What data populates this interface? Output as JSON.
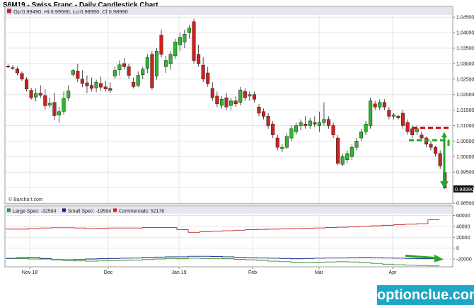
{
  "title": "S6M19 - Swiss Franc - Daily Candlestick Chart",
  "ohlc_label": "Op:0.99490, Hi:0.99590, Lo:0.98950, Cl:0.98990",
  "copyright": "© Barchart.com",
  "last_price": "0.98990",
  "brand": "optionclue.com",
  "colors": {
    "up": "#2db82d",
    "down": "#cc2222",
    "large": "#2f8f2f",
    "small": "#1a1a8c",
    "commercials": "#d02020",
    "arrow": "#22aa22",
    "resistance": "#cc1111",
    "support": "#22aa22"
  },
  "chart_data": [
    {
      "type": "candlestick",
      "x_ticks": [
        "Nov 18",
        "Dec",
        "Jan 19",
        "Feb",
        "Mar",
        "Apr"
      ],
      "y_ticks": [
        "1.04500",
        "1.04000",
        "1.03500",
        "1.03000",
        "1.02500",
        "1.02000",
        "1.01500",
        "1.01000",
        "1.00500",
        "1.00000",
        "0.99500",
        "0.99000",
        "0.98500"
      ],
      "ylim": [
        0.985,
        1.0455
      ],
      "candles": [
        {
          "o": 1.0292,
          "h": 1.0298,
          "l": 1.0285,
          "c": 1.0289
        },
        {
          "o": 1.0287,
          "h": 1.0294,
          "l": 1.028,
          "c": 1.0285
        },
        {
          "o": 1.0283,
          "h": 1.029,
          "l": 1.0262,
          "c": 1.027
        },
        {
          "o": 1.0268,
          "h": 1.0275,
          "l": 1.0244,
          "c": 1.025
        },
        {
          "o": 1.0248,
          "h": 1.0256,
          "l": 1.021,
          "c": 1.0218
        },
        {
          "o": 1.0214,
          "h": 1.0222,
          "l": 1.0184,
          "c": 1.019
        },
        {
          "o": 1.0192,
          "h": 1.022,
          "l": 1.0178,
          "c": 1.0204
        },
        {
          "o": 1.0205,
          "h": 1.023,
          "l": 1.0189,
          "c": 1.0198
        },
        {
          "o": 1.0197,
          "h": 1.0218,
          "l": 1.0152,
          "c": 1.0164
        },
        {
          "o": 1.0166,
          "h": 1.019,
          "l": 1.0158,
          "c": 1.0172
        },
        {
          "o": 1.0175,
          "h": 1.0206,
          "l": 1.0118,
          "c": 1.0132
        },
        {
          "o": 1.0134,
          "h": 1.016,
          "l": 1.011,
          "c": 1.0145
        },
        {
          "o": 1.0146,
          "h": 1.021,
          "l": 1.0135,
          "c": 1.0188
        },
        {
          "o": 1.019,
          "h": 1.023,
          "l": 1.018,
          "c": 1.0212
        },
        {
          "o": 1.0265,
          "h": 1.0282,
          "l": 1.0258,
          "c": 1.0278
        },
        {
          "o": 1.0276,
          "h": 1.03,
          "l": 1.024,
          "c": 1.0252
        },
        {
          "o": 1.025,
          "h": 1.0278,
          "l": 1.0224,
          "c": 1.0236
        },
        {
          "o": 1.0238,
          "h": 1.0262,
          "l": 1.0205,
          "c": 1.0228
        },
        {
          "o": 1.023,
          "h": 1.0255,
          "l": 1.021,
          "c": 1.022
        },
        {
          "o": 1.0222,
          "h": 1.0248,
          "l": 1.0208,
          "c": 1.024
        },
        {
          "o": 1.0236,
          "h": 1.0258,
          "l": 1.0212,
          "c": 1.0224
        },
        {
          "o": 1.0225,
          "h": 1.0245,
          "l": 1.021,
          "c": 1.0218
        },
        {
          "o": 1.022,
          "h": 1.024,
          "l": 1.0205,
          "c": 1.0214
        },
        {
          "o": 1.026,
          "h": 1.029,
          "l": 1.025,
          "c": 1.0278
        },
        {
          "o": 1.028,
          "h": 1.031,
          "l": 1.0262,
          "c": 1.0296
        },
        {
          "o": 1.03,
          "h": 1.0318,
          "l": 1.028,
          "c": 1.029
        },
        {
          "o": 1.029,
          "h": 1.03,
          "l": 1.025,
          "c": 1.0262
        },
        {
          "o": 1.024,
          "h": 1.0255,
          "l": 1.022,
          "c": 1.0226
        },
        {
          "o": 1.023,
          "h": 1.0275,
          "l": 1.0224,
          "c": 1.0262
        },
        {
          "o": 1.0264,
          "h": 1.029,
          "l": 1.025,
          "c": 1.0282
        },
        {
          "o": 1.0285,
          "h": 1.033,
          "l": 1.027,
          "c": 1.032
        },
        {
          "o": 1.033,
          "h": 1.034,
          "l": 1.0216,
          "c": 1.0222
        },
        {
          "o": 1.026,
          "h": 1.035,
          "l": 1.0248,
          "c": 1.034
        },
        {
          "o": 1.0392,
          "h": 1.041,
          "l": 1.032,
          "c": 1.033
        },
        {
          "o": 1.029,
          "h": 1.0325,
          "l": 1.027,
          "c": 1.031
        },
        {
          "o": 1.03,
          "h": 1.034,
          "l": 1.028,
          "c": 1.033
        },
        {
          "o": 1.0325,
          "h": 1.038,
          "l": 1.0315,
          "c": 1.037
        },
        {
          "o": 1.036,
          "h": 1.04,
          "l": 1.034,
          "c": 1.0385
        },
        {
          "o": 1.037,
          "h": 1.041,
          "l": 1.035,
          "c": 1.0395
        },
        {
          "o": 1.04,
          "h": 1.0425,
          "l": 1.038,
          "c": 1.0415
        },
        {
          "o": 1.0435,
          "h": 1.0445,
          "l": 1.03,
          "c": 1.031
        },
        {
          "o": 1.033,
          "h": 1.036,
          "l": 1.029,
          "c": 1.03
        },
        {
          "o": 1.0295,
          "h": 1.032,
          "l": 1.024,
          "c": 1.025
        },
        {
          "o": 1.027,
          "h": 1.029,
          "l": 1.0225,
          "c": 1.0235
        },
        {
          "o": 1.022,
          "h": 1.024,
          "l": 1.018,
          "c": 1.019
        },
        {
          "o": 1.0195,
          "h": 1.021,
          "l": 1.016,
          "c": 1.017
        },
        {
          "o": 1.0165,
          "h": 1.0195,
          "l": 1.0155,
          "c": 1.0185
        },
        {
          "o": 1.019,
          "h": 1.0205,
          "l": 1.015,
          "c": 1.016
        },
        {
          "o": 1.0165,
          "h": 1.019,
          "l": 1.015,
          "c": 1.018
        },
        {
          "o": 1.018,
          "h": 1.0195,
          "l": 1.016,
          "c": 1.017
        },
        {
          "o": 1.0175,
          "h": 1.0225,
          "l": 1.0165,
          "c": 1.0215
        },
        {
          "o": 1.021,
          "h": 1.022,
          "l": 1.018,
          "c": 1.019
        },
        {
          "o": 1.0195,
          "h": 1.021,
          "l": 1.018,
          "c": 1.02
        },
        {
          "o": 1.02,
          "h": 1.021,
          "l": 1.0175,
          "c": 1.0185
        },
        {
          "o": 1.016,
          "h": 1.017,
          "l": 1.013,
          "c": 1.014
        },
        {
          "o": 1.0145,
          "h": 1.0155,
          "l": 1.012,
          "c": 1.013
        },
        {
          "o": 1.013,
          "h": 1.014,
          "l": 1.009,
          "c": 1.01
        },
        {
          "o": 1.0105,
          "h": 1.0115,
          "l": 1.006,
          "c": 1.007
        },
        {
          "o": 1.006,
          "h": 1.007,
          "l": 1.002,
          "c": 1.003
        },
        {
          "o": 1.0025,
          "h": 1.004,
          "l": 1.0015,
          "c": 1.003
        },
        {
          "o": 1.003,
          "h": 1.0075,
          "l": 1.0025,
          "c": 1.0065
        },
        {
          "o": 1.006,
          "h": 1.01,
          "l": 1.005,
          "c": 1.009
        },
        {
          "o": 1.008,
          "h": 1.011,
          "l": 1.007,
          "c": 1.01
        },
        {
          "o": 1.01,
          "h": 1.012,
          "l": 1.0085,
          "c": 1.011
        },
        {
          "o": 1.0105,
          "h": 1.013,
          "l": 1.009,
          "c": 1.01
        },
        {
          "o": 1.01,
          "h": 1.0125,
          "l": 1.009,
          "c": 1.0115
        },
        {
          "o": 1.011,
          "h": 1.013,
          "l": 1.0095,
          "c": 1.0105
        },
        {
          "o": 1.01,
          "h": 1.0145,
          "l": 1.008,
          "c": 1.011
        },
        {
          "o": 1.011,
          "h": 1.0175,
          "l": 1.01,
          "c": 1.012
        },
        {
          "o": 1.012,
          "h": 1.013,
          "l": 1.009,
          "c": 1.01
        },
        {
          "o": 1.01,
          "h": 1.011,
          "l": 1.006,
          "c": 1.007
        },
        {
          "o": 1.006,
          "h": 1.007,
          "l": 0.9972,
          "c": 0.9978
        },
        {
          "o": 0.9975,
          "h": 1.001,
          "l": 0.997,
          "c": 1.0
        },
        {
          "o": 0.999,
          "h": 1.002,
          "l": 0.9978,
          "c": 1.001
        },
        {
          "o": 1.0,
          "h": 1.004,
          "l": 0.999,
          "c": 1.003
        },
        {
          "o": 1.003,
          "h": 1.006,
          "l": 1.002,
          "c": 1.005
        },
        {
          "o": 1.006,
          "h": 1.009,
          "l": 1.005,
          "c": 1.008
        },
        {
          "o": 1.008,
          "h": 1.0115,
          "l": 1.007,
          "c": 1.0105
        },
        {
          "o": 1.01,
          "h": 1.019,
          "l": 1.009,
          "c": 1.018
        },
        {
          "o": 1.017,
          "h": 1.018,
          "l": 1.015,
          "c": 1.016
        },
        {
          "o": 1.016,
          "h": 1.0185,
          "l": 1.015,
          "c": 1.0175
        },
        {
          "o": 1.0175,
          "h": 1.0185,
          "l": 1.015,
          "c": 1.016
        },
        {
          "o": 1.015,
          "h": 1.016,
          "l": 1.012,
          "c": 1.013
        },
        {
          "o": 1.013,
          "h": 1.014,
          "l": 1.012,
          "c": 1.0135
        },
        {
          "o": 1.013,
          "h": 1.0135,
          "l": 1.012,
          "c": 1.0125
        },
        {
          "o": 1.014,
          "h": 1.015,
          "l": 1.009,
          "c": 1.01
        },
        {
          "o": 1.011,
          "h": 1.012,
          "l": 1.007,
          "c": 1.008
        },
        {
          "o": 1.009,
          "h": 1.01,
          "l": 1.006,
          "c": 1.007
        },
        {
          "o": 1.008,
          "h": 1.01,
          "l": 1.007,
          "c": 1.009
        },
        {
          "o": 1.007,
          "h": 1.008,
          "l": 1.005,
          "c": 1.006
        },
        {
          "o": 1.006,
          "h": 1.0065,
          "l": 1.003,
          "c": 1.004
        },
        {
          "o": 1.004,
          "h": 1.005,
          "l": 1.002,
          "c": 1.003
        },
        {
          "o": 1.003,
          "h": 1.0035,
          "l": 1.0,
          "c": 1.001
        },
        {
          "o": 1.001,
          "h": 1.002,
          "l": 0.996,
          "c": 0.997
        },
        {
          "o": 0.9949,
          "h": 0.9959,
          "l": 0.9895,
          "c": 0.9899
        }
      ],
      "annotations": {
        "resistance": 1.0093,
        "support": 1.0053,
        "arrow": {
          "from": 1.008,
          "to": 0.99
        }
      }
    },
    {
      "type": "line",
      "legend": [
        {
          "key": "large",
          "label": "Large Spec: -32584"
        },
        {
          "key": "small",
          "label": "Small Spec: -19594"
        },
        {
          "key": "commercials",
          "label": "Commercials: 52178"
        }
      ],
      "y_ticks": [
        "60000",
        "40000",
        "20000",
        "0",
        "-20000"
      ],
      "ylim": [
        -33000,
        62000
      ],
      "series": [
        {
          "key": "commercials",
          "values": [
            35000,
            35000,
            36000,
            37000,
            37500,
            37500,
            37000,
            36000,
            36500,
            37000,
            37000,
            37000,
            38000,
            38000,
            38000,
            34000,
            29000,
            30000,
            31000,
            32000,
            33000,
            34000,
            34500,
            35000,
            35500,
            36000,
            36500,
            37000,
            38000,
            38500,
            39000,
            40000,
            41000,
            42000,
            43000,
            44000,
            45000,
            52178
          ]
        },
        {
          "key": "small",
          "values": [
            -19000,
            -17500,
            -17000,
            -19000,
            -21000,
            -21500,
            -21000,
            -20000,
            -19500,
            -19000,
            -18500,
            -18000,
            -17000,
            -16500,
            -16000,
            -16000,
            -15000,
            -15000,
            -15500,
            -16000,
            -17000,
            -17500,
            -18000,
            -18500,
            -19000,
            -19500,
            -19000,
            -18500,
            -18000,
            -18000,
            -17500,
            -17000,
            -17500,
            -18000,
            -18500,
            -19000,
            -19500,
            -19594
          ]
        },
        {
          "key": "large",
          "values": [
            -18500,
            -19000,
            -20000,
            -20000,
            -21500,
            -22500,
            -23500,
            -24000,
            -23500,
            -23000,
            -22500,
            -22000,
            -21000,
            -20000,
            -19000,
            -19500,
            -18500,
            -19000,
            -19000,
            -19500,
            -20500,
            -21500,
            -22500,
            -24000,
            -25000,
            -26000,
            -26500,
            -26000,
            -25500,
            -25000,
            -25500,
            -26500,
            -28000,
            -29500,
            -30500,
            -31500,
            -32000,
            -32584
          ]
        }
      ],
      "annotations": {
        "arrow": {
          "from": -14000,
          "to": -19500
        }
      }
    }
  ]
}
